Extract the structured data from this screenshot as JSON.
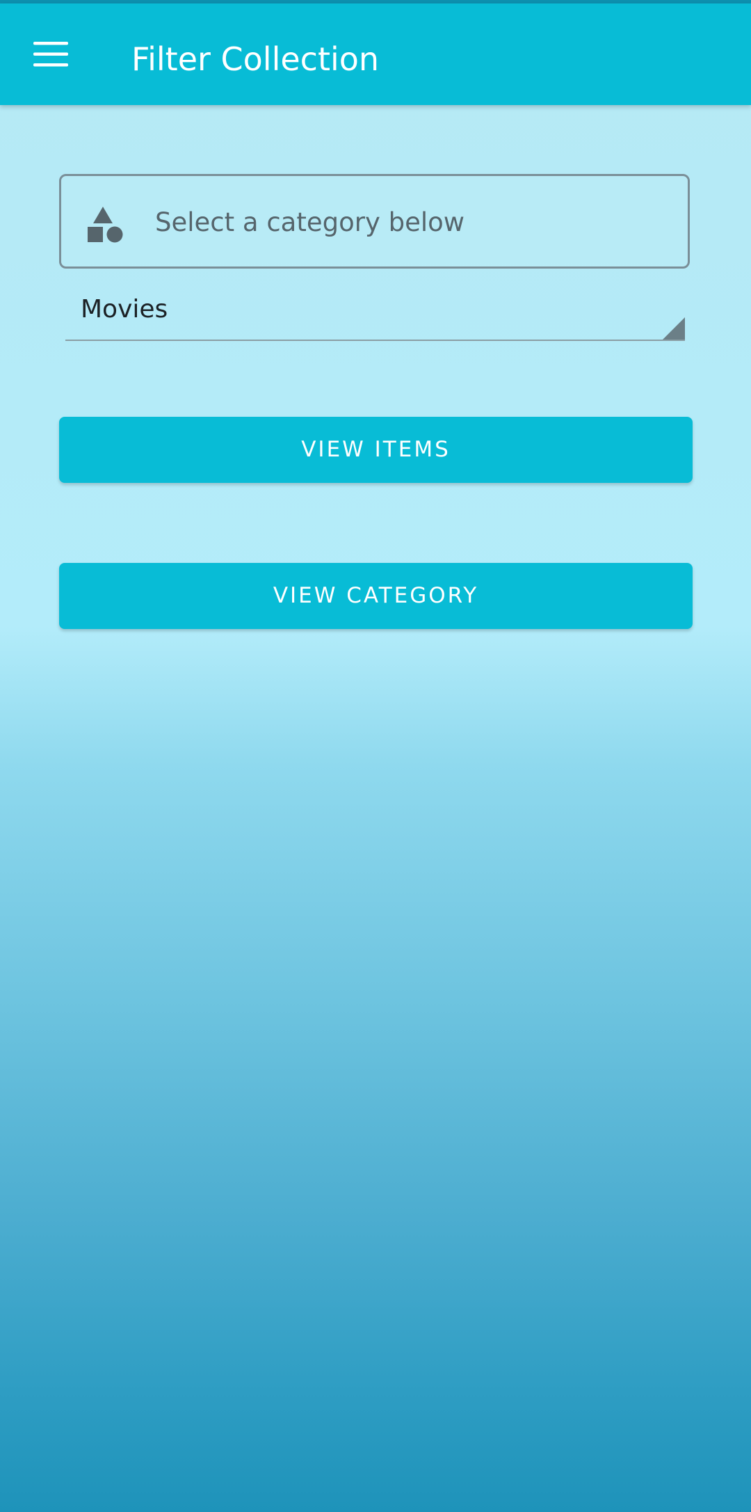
{
  "colors": {
    "accent": "#08bcd6",
    "icon": "#56656c"
  },
  "appbar": {
    "menu_icon": "hamburger-menu-icon",
    "title": "Filter Collection"
  },
  "category_box": {
    "icon": "shapes-icon",
    "label": "Select a category below"
  },
  "spinner": {
    "selected": "Movies",
    "arrow_icon": "dropdown-triangle-icon"
  },
  "buttons": {
    "view_items": "VIEW ITEMS",
    "view_category": "VIEW CATEGORY"
  }
}
